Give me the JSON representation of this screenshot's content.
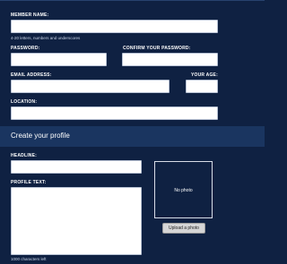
{
  "account": {
    "member_name_label": "MEMBER NAME:",
    "member_name_value": "",
    "member_name_hint": "4-20 letters, numbers and underscores",
    "password_label": "PASSWORD:",
    "password_value": "",
    "confirm_password_label": "CONFIRM YOUR PASSWORD:",
    "confirm_password_value": "",
    "email_label": "EMAIL ADDRESS:",
    "email_value": "",
    "age_label": "YOUR AGE:",
    "age_value": "",
    "location_label": "LOCATION:",
    "location_value": ""
  },
  "profile": {
    "section_title": "Create your profile",
    "headline_label": "HEADLINE:",
    "headline_value": "",
    "profile_text_label": "PROFILE TEXT:",
    "profile_text_value": "",
    "characters_left": "1000 characters left",
    "photo_placeholder": "No photo",
    "upload_button_label": "Upload a photo"
  },
  "colors": {
    "background": "#0f2142",
    "section_header": "#1a3560",
    "field": "#ffffff",
    "button": "#d6d6d6"
  }
}
